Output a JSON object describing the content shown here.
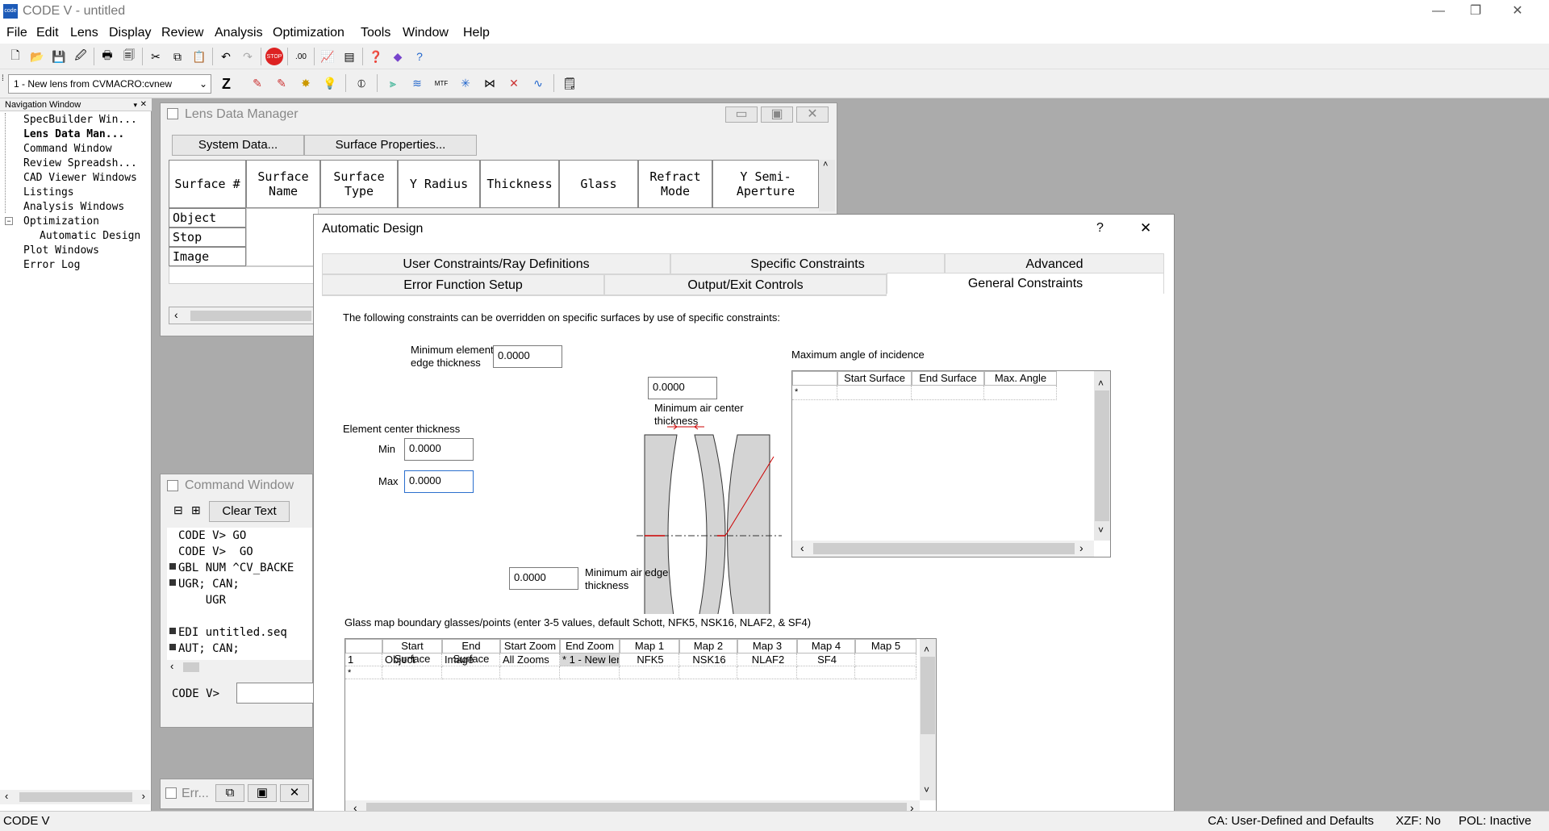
{
  "app": {
    "title": "CODE V - untitled",
    "icon_text": "code"
  },
  "window_controls": {
    "minimize": "—",
    "restore": "❐",
    "close": "✕"
  },
  "menu": [
    "File",
    "Edit",
    "Lens",
    "Display",
    "Review",
    "Analysis",
    "Optimization",
    "Tools",
    "Window",
    "Help"
  ],
  "toolbar": {
    "macro_select": "1 - New lens from CVMACRO:cvnew",
    "z_label": "Z"
  },
  "nav": {
    "title": "Navigation Window",
    "items": [
      "SpecBuilder Win...",
      "Lens Data Man...",
      "Command Window",
      "Review Spreadsh...",
      "CAD Viewer Windows",
      "Listings",
      "Analysis Windows",
      "Optimization",
      "Automatic Design",
      "Plot Windows",
      "Error Log"
    ]
  },
  "ldm": {
    "title": "Lens Data Manager",
    "system_data_btn": "System Data...",
    "surface_props_btn": "Surface Properties...",
    "columns": [
      "Surface #",
      "Surface Name",
      "Surface Type",
      "Y Radius",
      "Thickness",
      "Glass",
      "Refract Mode",
      "Y Semi-Aperture"
    ],
    "rows": [
      "Object",
      "Stop",
      "Image"
    ]
  },
  "cmd": {
    "title": "Command Window",
    "clear_btn": "Clear Text",
    "lines": [
      "CODE V> GO",
      "CODE V>  GO",
      "GBL NUM ^CV_BACKE",
      "UGR; CAN;",
      "    UGR",
      "",
      "EDI untitled.seq",
      "AUT; CAN;"
    ],
    "prompt": "CODE V>"
  },
  "err_window": {
    "title": "Err..."
  },
  "dialog": {
    "title": "Automatic Design",
    "help": "?",
    "close": "✕",
    "tabs_row1": [
      "User Constraints/Ray Definitions",
      "Specific Constraints",
      "Advanced"
    ],
    "tabs_row2": [
      "Error Function Setup",
      "Output/Exit Controls",
      "General Constraints"
    ],
    "intro": "The following constraints can be overridden on specific surfaces by use of specific constraints:",
    "min_edge_label_1": "Minimum element",
    "min_edge_label_2": "edge thickness",
    "min_edge_value": "0.0000",
    "min_air_center_value": "0.0000",
    "min_air_center_label_1": "Minimum air center",
    "min_air_center_label_2": "thickness",
    "center_thickness_label": "Element center thickness",
    "min_label": "Min",
    "min_value": "0.0000",
    "max_label": "Max",
    "max_value": "0.0000",
    "min_air_edge_value": "0.0000",
    "min_air_edge_label_1": "Minimum air edge",
    "min_air_edge_label_2": "thickness",
    "angle_title": "Maximum angle of incidence",
    "angle_columns": [
      "Start Surface",
      "End Surface",
      "Max. Angle"
    ],
    "angle_new_row": "*",
    "glass_title": "Glass map boundary glasses/points (enter 3-5 values, default Schott, NFK5, NSK16, NLAF2, & SF4)",
    "glass_columns": [
      "Start Surface",
      "End Surface",
      "Start Zoom",
      "End Zoom",
      "Map 1",
      "Map 2",
      "Map 3",
      "Map 4",
      "Map 5"
    ],
    "glass_rows": [
      [
        "1",
        "Object",
        "Image",
        "All Zooms",
        "* 1 - New len",
        "NFK5",
        "NSK16",
        "NLAF2",
        "SF4",
        ""
      ],
      [
        "*",
        "",
        "",
        "",
        "",
        "",
        "",
        "",
        "",
        ""
      ]
    ]
  },
  "status": {
    "left": "CODE V",
    "ca": "CA: User-Defined and Defaults",
    "xzf": "XZF: No",
    "pol": "POL: Inactive"
  }
}
